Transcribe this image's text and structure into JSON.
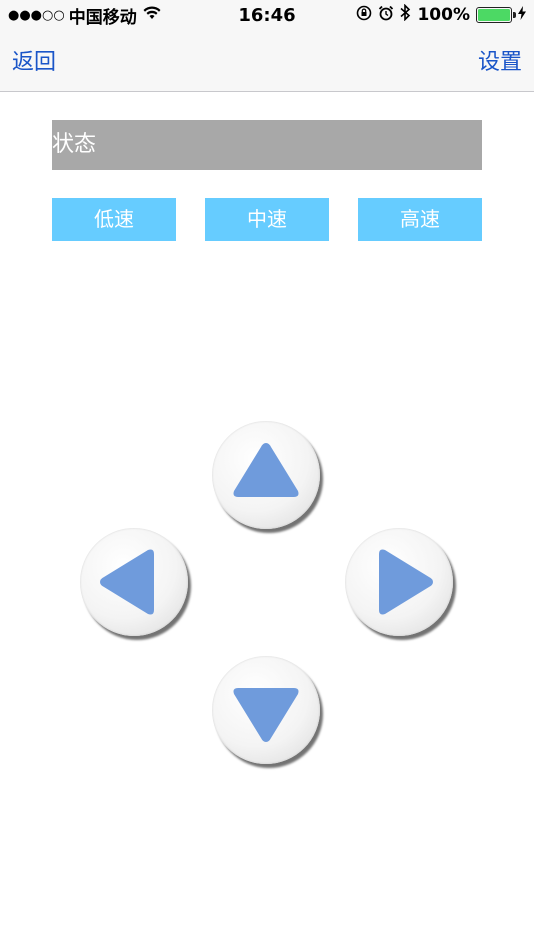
{
  "status_bar": {
    "signal": "●●●○○",
    "carrier": "中国移动",
    "wifi_icon": "wifi-icon",
    "time": "16:46",
    "battery_percent": "100%",
    "battery_level": 1.0,
    "battery_color": "#4cd964"
  },
  "nav": {
    "back_label": "返回",
    "settings_label": "设置",
    "accent_color": "#1a55c8"
  },
  "status_field": {
    "label": "状态"
  },
  "speed_buttons": {
    "low": "低速",
    "mid": "中速",
    "high": "高速",
    "color": "#66ccff"
  },
  "dpad": {
    "up": "arrow-up-icon",
    "left": "arrow-left-icon",
    "right": "arrow-right-icon",
    "down": "arrow-down-icon",
    "arrow_color": "#6f9bdc"
  }
}
